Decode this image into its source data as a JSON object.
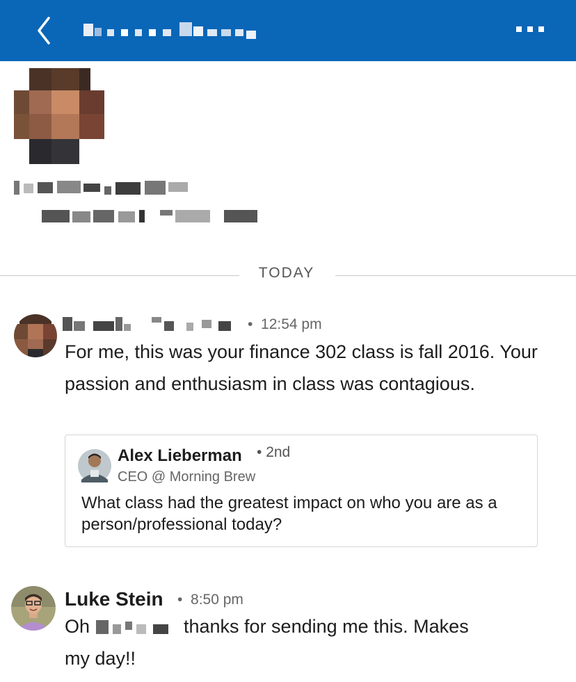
{
  "header": {
    "back_icon": "chevron-left-icon",
    "more_icon": "more-horizontal-icon",
    "accent_color": "#0a66b7"
  },
  "conversation": {
    "date_divider": "TODAY"
  },
  "messages": [
    {
      "time": "12:54 pm",
      "text": "For me, this was your finance 302 class is fall 2016. Your passion and enthusiasm in class was contagious.",
      "shared_post": {
        "author": "Alex Lieberman",
        "degree": "2nd",
        "headline": "CEO @ Morning Brew",
        "text": "What class had the greatest impact on who you are as a person/professional today?"
      }
    },
    {
      "sender": "Luke Stein",
      "time": "8:50 pm",
      "text_before": "Oh",
      "text_after": "thanks for sending me this. Makes",
      "text_line2": "my day!!"
    }
  ]
}
